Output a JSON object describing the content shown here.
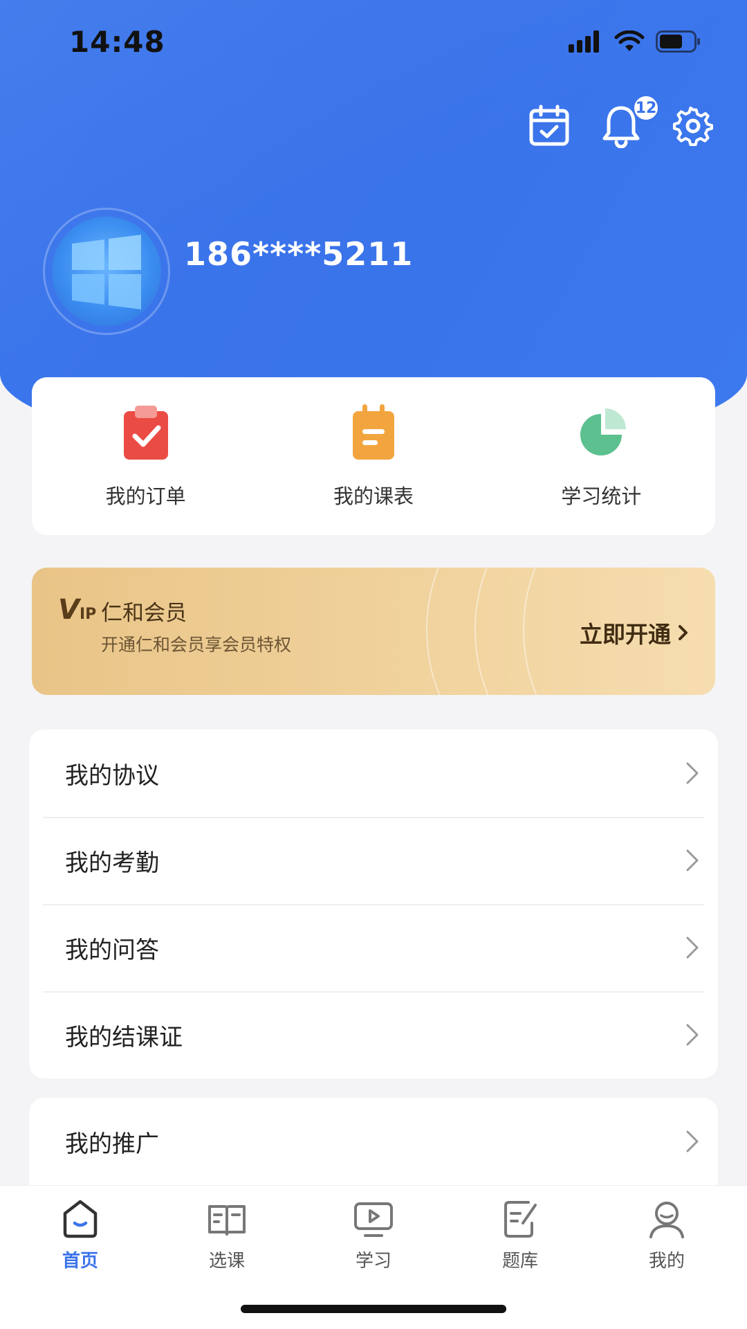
{
  "status": {
    "time": "14:48"
  },
  "header": {
    "notification_count": "12",
    "phone": "186****5211"
  },
  "quick": [
    {
      "label": "我的订单",
      "icon": "order-clipboard-icon"
    },
    {
      "label": "我的课表",
      "icon": "schedule-notepad-icon"
    },
    {
      "label": "学习统计",
      "icon": "pie-chart-icon"
    }
  ],
  "vip": {
    "logo": "V",
    "logo_suffix": "IP",
    "title": "仁和会员",
    "subtitle": "开通仁和会员享会员特权",
    "button": "立即开通"
  },
  "menu1": [
    "我的协议",
    "我的考勤",
    "我的问答",
    "我的结课证"
  ],
  "menu2": [
    "我的推广"
  ],
  "tabs": [
    {
      "label": "首页",
      "active": true
    },
    {
      "label": "选课"
    },
    {
      "label": "学习"
    },
    {
      "label": "题库"
    },
    {
      "label": "我的"
    }
  ],
  "colors": {
    "primary": "#3a73ea",
    "vip_gold": "#eecb90"
  }
}
